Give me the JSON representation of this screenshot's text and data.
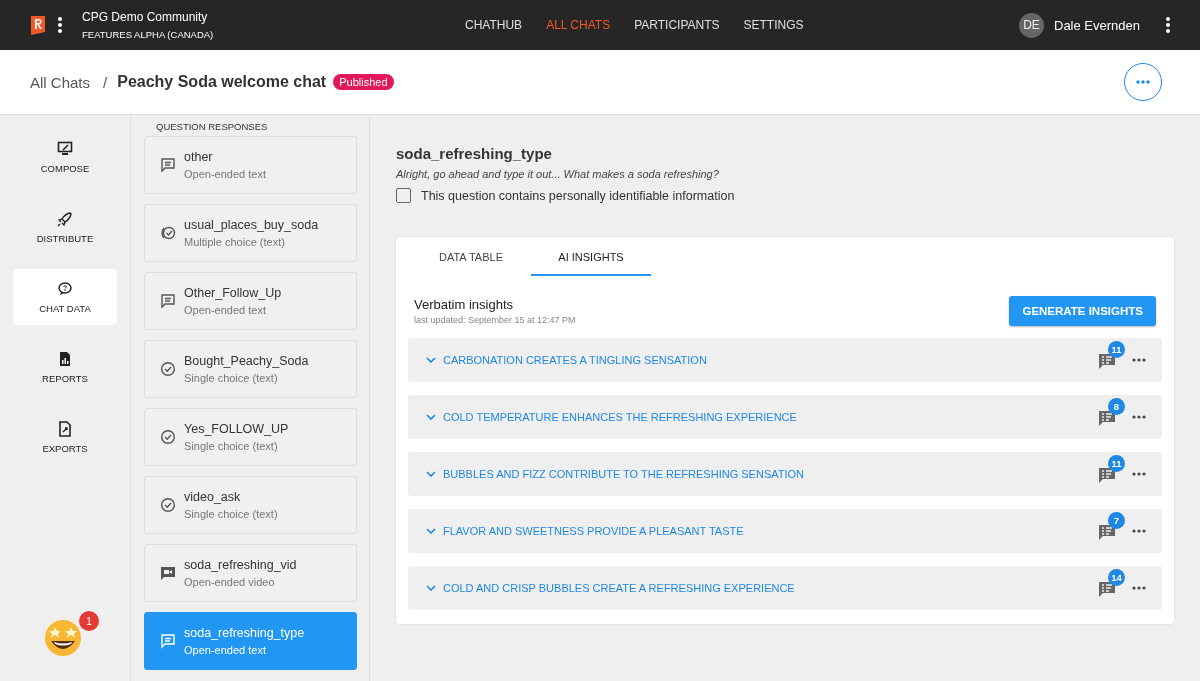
{
  "topbar": {
    "community": "CPG Demo Community",
    "subtitle": "FEATURES ALPHA (CANADA)",
    "nav": [
      {
        "label": "CHATHUB",
        "selected": false
      },
      {
        "label": "ALL CHATS",
        "selected": true
      },
      {
        "label": "PARTICIPANTS",
        "selected": false
      },
      {
        "label": "SETTINGS",
        "selected": false
      }
    ],
    "user": {
      "initials": "DE",
      "name": "Dale Evernden"
    }
  },
  "header": {
    "breadcrumb": "All Chats",
    "separator": "/",
    "title": "Peachy Soda welcome chat",
    "status": "Published"
  },
  "sidebar": {
    "items": [
      {
        "kind": "compose",
        "label": "COMPOSE",
        "selected": false
      },
      {
        "kind": "distribute",
        "label": "DISTRIBUTE",
        "selected": false
      },
      {
        "kind": "chat",
        "label": "CHAT DATA",
        "selected": true
      },
      {
        "kind": "reports",
        "label": "REPORTS",
        "selected": false
      },
      {
        "kind": "exports",
        "label": "EXPORTS",
        "selected": false
      }
    ],
    "notification_count": "1"
  },
  "questions": {
    "heading": "QUESTION RESPONSES",
    "items": [
      {
        "kind": "text",
        "name": "other",
        "type": "Open-ended text",
        "selected": false
      },
      {
        "kind": "multiple",
        "name": "usual_places_buy_soda",
        "type": "Multiple choice (text)",
        "selected": false
      },
      {
        "kind": "text",
        "name": "Other_Follow_Up",
        "type": "Open-ended text",
        "selected": false
      },
      {
        "kind": "single",
        "name": "Bought_Peachy_Soda",
        "type": "Single choice (text)",
        "selected": false
      },
      {
        "kind": "single",
        "name": "Yes_FOLLOW_UP",
        "type": "Single choice (text)",
        "selected": false
      },
      {
        "kind": "single",
        "name": "video_ask",
        "type": "Single choice (text)",
        "selected": false
      },
      {
        "kind": "video",
        "name": "soda_refreshing_vid",
        "type": "Open-ended video",
        "selected": false
      },
      {
        "kind": "text",
        "name": "soda_refreshing_type",
        "type": "Open-ended text",
        "selected": true
      }
    ]
  },
  "detail": {
    "title": "soda_refreshing_type",
    "prompt": "Alright, go ahead and type it out... What makes a soda refreshing?",
    "pii": {
      "label": "This question contains personally identifiable information",
      "checked": false
    },
    "tabs": [
      {
        "label": "DATA TABLE",
        "selected": false
      },
      {
        "label": "AI INSIGHTS",
        "selected": true
      }
    ],
    "insights_title": "Verbatim insights",
    "last_updated": "last updated: September 15 at 12:47 PM",
    "generate_button": "GENERATE INSIGHTS",
    "insights": [
      {
        "label": "CARBONATION CREATES A TINGLING SENSATION",
        "count": "11"
      },
      {
        "label": "COLD TEMPERATURE ENHANCES THE REFRESHING EXPERIENCE",
        "count": "8"
      },
      {
        "label": "BUBBLES AND FIZZ CONTRIBUTE TO THE REFRESHING SENSATION",
        "count": "11"
      },
      {
        "label": "FLAVOR AND SWEETNESS PROVIDE A PLEASANT TASTE",
        "count": "7"
      },
      {
        "label": "COLD AND CRISP BUBBLES CREATE A REFRESHING EXPERIENCE",
        "count": "14"
      }
    ]
  }
}
